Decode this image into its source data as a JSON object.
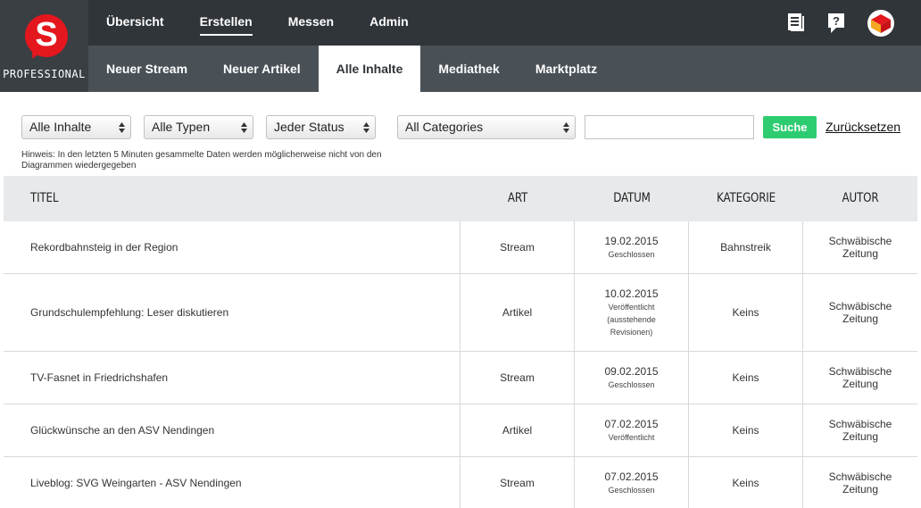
{
  "brand": {
    "logo_letter": "S",
    "subtitle": "PROFESSIONAL",
    "logo_color": "#e3171d"
  },
  "top_nav": [
    {
      "label": "Übersicht",
      "active": false
    },
    {
      "label": "Erstellen",
      "active": true
    },
    {
      "label": "Messen",
      "active": false
    },
    {
      "label": "Admin",
      "active": false
    }
  ],
  "header_icons": [
    "document-list-icon",
    "help-icon",
    "avatar"
  ],
  "sub_nav": [
    {
      "label": "Neuer Stream",
      "active": false
    },
    {
      "label": "Neuer Artikel",
      "active": false
    },
    {
      "label": "Alle Inhalte",
      "active": true
    },
    {
      "label": "Mediathek",
      "active": false
    },
    {
      "label": "Marktplatz",
      "active": false
    }
  ],
  "filters": {
    "scope": "Alle Inhalte",
    "types": "Alle Typen",
    "status": "Jeder Status",
    "categories": "All Categories",
    "search_value": "",
    "search_button": "Suche",
    "reset_link": "Zurücksetzen"
  },
  "hint": "Hinweis: In den letzten 5 Minuten gesammelte Daten werden möglicherweise nicht von den Diagrammen wiedergegeben",
  "table": {
    "columns": [
      "TITEL",
      "ART",
      "DATUM",
      "KATEGORIE",
      "AUTOR"
    ],
    "rows": [
      {
        "title": "Rekordbahnsteig in der Region",
        "art": "Stream",
        "date": "19.02.2015",
        "status": "Geschlossen",
        "category": "Bahnstreik",
        "author": "Schwäbische Zeitung"
      },
      {
        "title": "Grundschulempfehlung: Leser diskutieren",
        "art": "Artikel",
        "date": "10.02.2015",
        "status": "Veröffentlicht (ausstehende Revisionen)",
        "category": "Keins",
        "author": "Schwäbische Zeitung"
      },
      {
        "title": "TV-Fasnet in Friedrichshafen",
        "art": "Stream",
        "date": "09.02.2015",
        "status": "Geschlossen",
        "category": "Keins",
        "author": "Schwäbische Zeitung"
      },
      {
        "title": "Glückwünsche an den ASV Nendingen",
        "art": "Artikel",
        "date": "07.02.2015",
        "status": "Veröffentlicht",
        "category": "Keins",
        "author": "Schwäbische Zeitung"
      },
      {
        "title": "Liveblog: SVG Weingarten - ASV Nendingen",
        "art": "Stream",
        "date": "07.02.2015",
        "status": "Geschlossen",
        "category": "Keins",
        "author": "Schwäbische Zeitung"
      }
    ]
  },
  "colors": {
    "topbar": "#30353a",
    "subbar": "#495157",
    "accent_green": "#2ecc71",
    "table_header": "#e7e9eb"
  }
}
